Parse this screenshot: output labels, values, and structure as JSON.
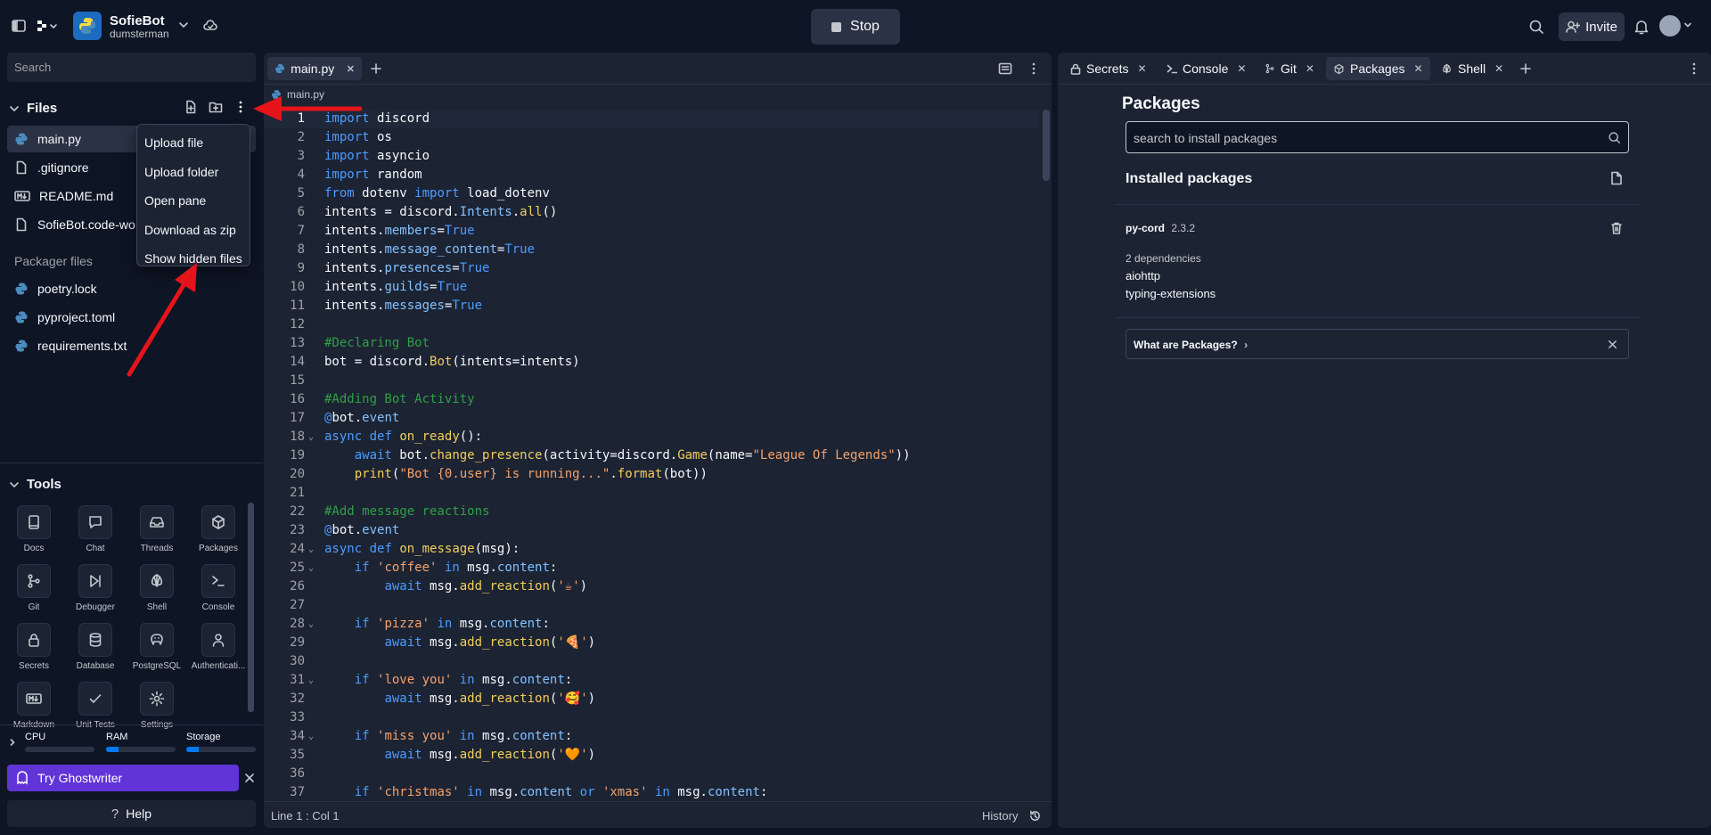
{
  "topbar": {
    "repl_name": "SofieBot",
    "owner": "dumsterman",
    "stop_label": "Stop",
    "invite_label": "Invite"
  },
  "sidebar": {
    "search_placeholder": "Search",
    "files_title": "Files",
    "files": [
      {
        "name": "main.py",
        "icon": "python-icon",
        "active": true
      },
      {
        "name": ".gitignore",
        "icon": "file-icon"
      },
      {
        "name": "README.md",
        "icon": "markdown-icon"
      },
      {
        "name": "SofieBot.code-wo",
        "icon": "file-icon"
      }
    ],
    "packager_title": "Packager files",
    "packager_files": [
      {
        "name": "poetry.lock",
        "icon": "python-icon"
      },
      {
        "name": "pyproject.toml",
        "icon": "python-icon"
      },
      {
        "name": "requirements.txt",
        "icon": "python-icon"
      }
    ],
    "tools_title": "Tools",
    "tools": [
      {
        "label": "Docs",
        "icon": "book-icon"
      },
      {
        "label": "Chat",
        "icon": "chat-icon"
      },
      {
        "label": "Threads",
        "icon": "inbox-icon"
      },
      {
        "label": "Packages",
        "icon": "package-icon"
      },
      {
        "label": "Git",
        "icon": "git-icon"
      },
      {
        "label": "Debugger",
        "icon": "debugger-icon"
      },
      {
        "label": "Shell",
        "icon": "shell-icon"
      },
      {
        "label": "Console",
        "icon": "console-icon"
      },
      {
        "label": "Secrets",
        "icon": "lock-icon"
      },
      {
        "label": "Database",
        "icon": "database-icon"
      },
      {
        "label": "PostgreSQL",
        "icon": "postgresql-icon"
      },
      {
        "label": "Authenticati...",
        "icon": "user-icon"
      },
      {
        "label": "Markdown",
        "icon": "markdown-icon"
      },
      {
        "label": "Unit Tests",
        "icon": "check-icon"
      },
      {
        "label": "Settings",
        "icon": "gear-icon"
      }
    ],
    "resources": {
      "cpu_label": "CPU",
      "ram_label": "RAM",
      "storage_label": "Storage",
      "cpu": 0.0,
      "ram": 0.18,
      "storage": 0.18
    },
    "ghostwriter_label": "Try Ghostwriter",
    "help_label": "Help"
  },
  "context_menu": {
    "items": [
      "Upload file",
      "Upload folder",
      "Open pane",
      "Download as zip",
      "Show hidden files"
    ]
  },
  "editor": {
    "tab_label": "main.py",
    "breadcrumb": "main.py",
    "status_position": "Line 1 : Col 1",
    "history_label": "History",
    "lines": [
      "import discord",
      "import os",
      "import asyncio",
      "import random",
      "from dotenv import load_dotenv",
      "intents = discord.Intents.all()",
      "intents.members=True",
      "intents.message_content=True",
      "intents.presences=True",
      "intents.guilds=True",
      "intents.messages=True",
      "",
      "#Declaring Bot",
      "bot = discord.Bot(intents=intents)",
      "",
      "#Adding Bot Activity",
      "@bot.event",
      "async def on_ready():",
      "    await bot.change_presence(activity=discord.Game(name=\"League Of Legends\"))",
      "    print(\"Bot {0.user} is running...\".format(bot))",
      "",
      "#Add message reactions",
      "@bot.event",
      "async def on_message(msg):",
      "    if 'coffee' in msg.content:",
      "        await msg.add_reaction('☕')",
      "",
      "    if 'pizza' in msg.content:",
      "        await msg.add_reaction('🍕')",
      "",
      "    if 'love you' in msg.content:",
      "        await msg.add_reaction('🥰')",
      "",
      "    if 'miss you' in msg.content:",
      "        await msg.add_reaction('🧡')",
      "",
      "    if 'christmas' in msg.content or 'xmas' in msg.content:"
    ]
  },
  "right_pane": {
    "tabs": [
      {
        "label": "Secrets",
        "icon": "lock-icon"
      },
      {
        "label": "Console",
        "icon": "console-icon"
      },
      {
        "label": "Git",
        "icon": "git-icon"
      },
      {
        "label": "Packages",
        "icon": "package-icon",
        "active": true
      },
      {
        "label": "Shell",
        "icon": "shell-icon"
      }
    ],
    "title": "Packages",
    "search_placeholder": "search to install packages",
    "installed_title": "Installed packages",
    "package": {
      "name": "py-cord",
      "version": "2.3.2",
      "deps_label": "2 dependencies",
      "deps": [
        "aiohttp",
        "typing-extensions"
      ]
    },
    "info_label": "What are Packages?"
  },
  "colors": {
    "bg": "#0e1525",
    "surface": "#1c2333",
    "accent": "#0079f2",
    "ghostwriter": "#6134d8",
    "annotation_arrow": "#e5141b"
  }
}
